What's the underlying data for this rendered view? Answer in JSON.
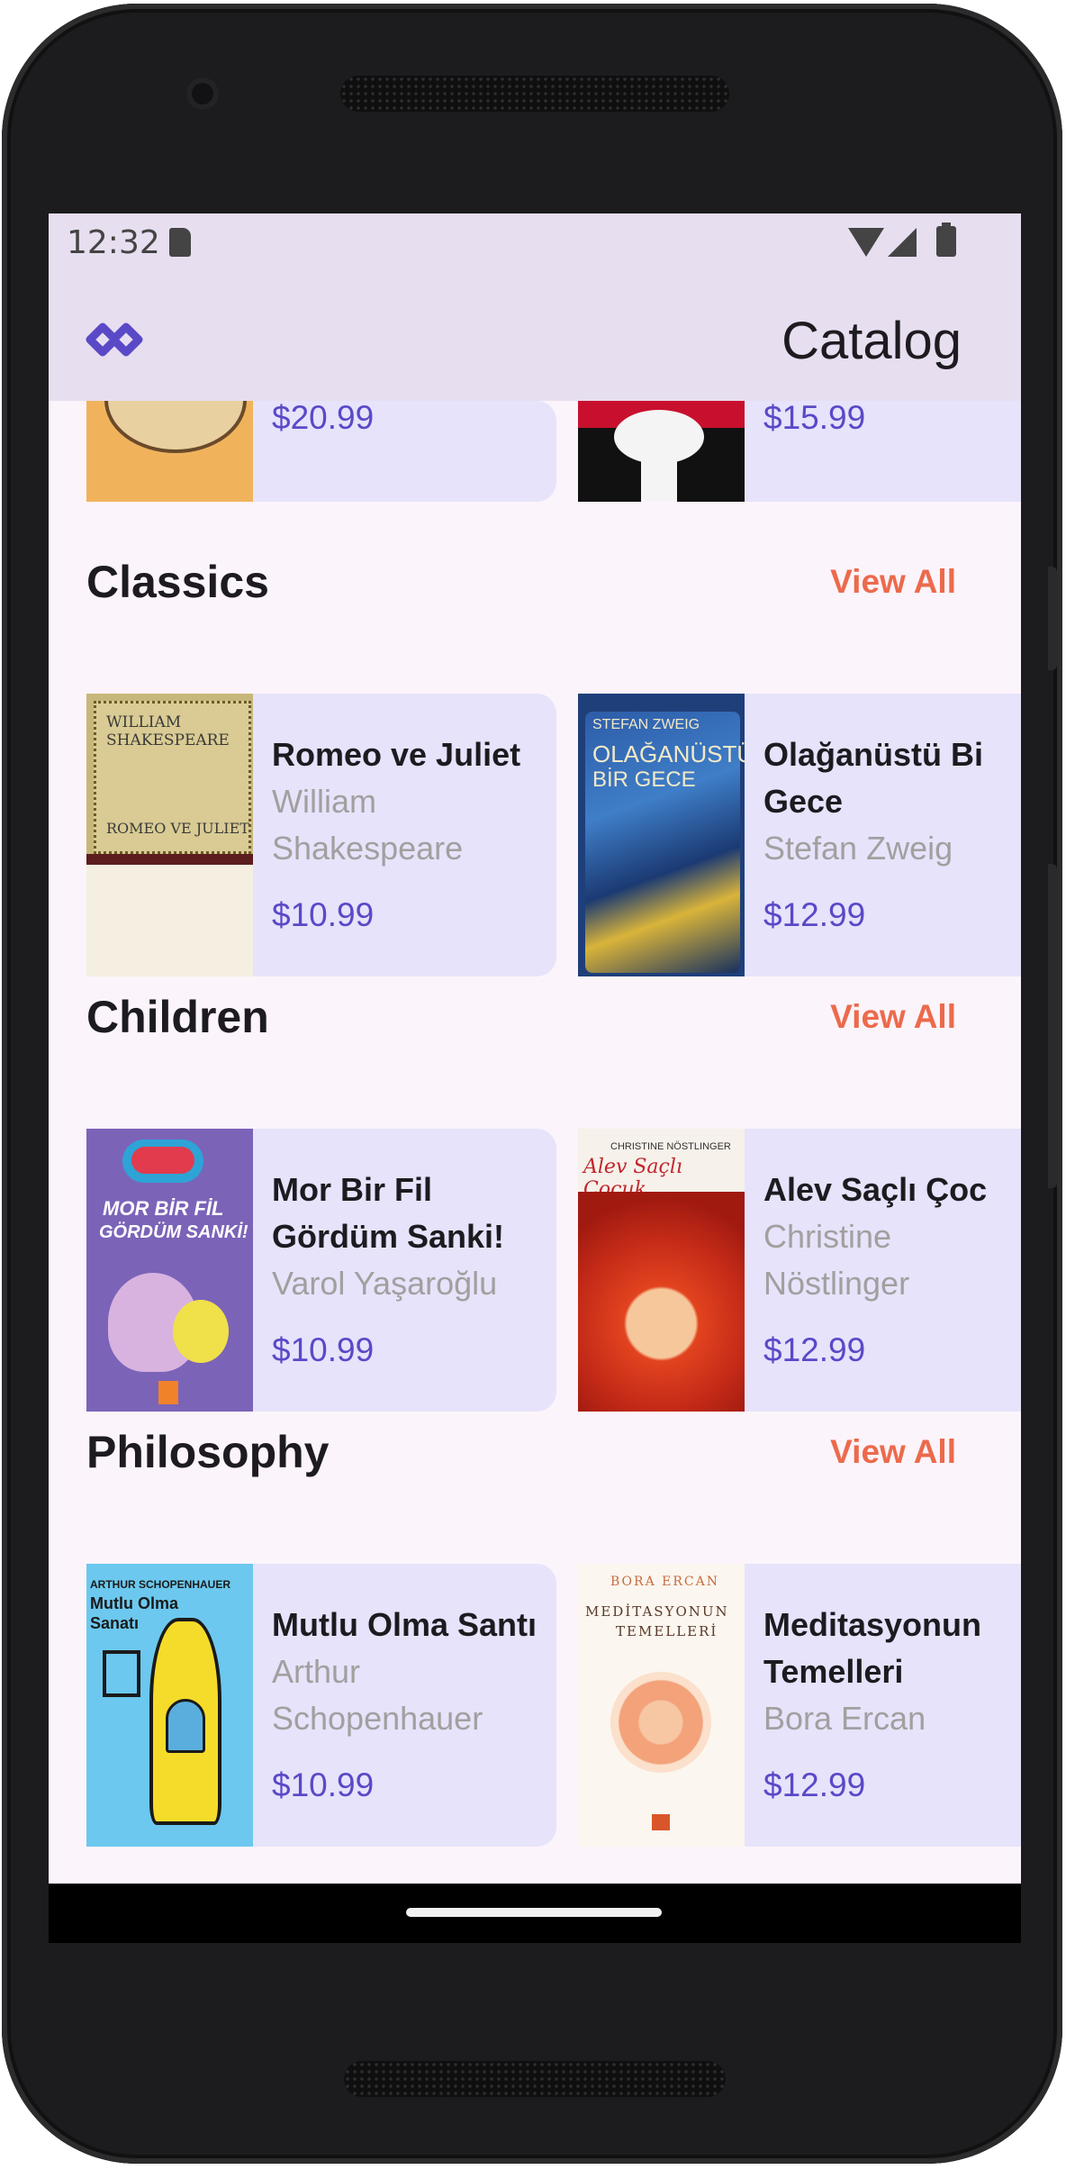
{
  "status": {
    "time": "12:32"
  },
  "appbar": {
    "title": "Catalog",
    "logo": "logo-icon"
  },
  "colors": {
    "accent": "#5a49c7",
    "view_all": "#ec6a4c",
    "card_bg": "#e6e3fb",
    "appbar_bg": "#e7def0"
  },
  "top_row": {
    "left_price": "$20.99",
    "right_price": "$15.99"
  },
  "sections": [
    {
      "title": "Classics",
      "view_all": "View All",
      "books": [
        {
          "title": "Romeo ve Juliet",
          "author": "William\nShakespeare",
          "price": "$10.99",
          "cover": {
            "line1": "WILLIAM",
            "line2": "SHAKESPEARE",
            "line3": "ROMEO VE JULIET"
          }
        },
        {
          "title": "Olağanüstü Bi\nGece",
          "author": "Stefan Zweig",
          "price": "$12.99",
          "cover": {
            "line1": "STEFAN ZWEIG",
            "line2": "OLAĞANÜSTÜ",
            "line3": "BİR GECE"
          }
        }
      ]
    },
    {
      "title": "Children",
      "view_all": "View All",
      "books": [
        {
          "title": "Mor Bir Fil\nGördüm Sanki!",
          "author": "Varol Yaşaroğlu",
          "price": "$10.99",
          "cover": {
            "line1": "MOR BİR FİL",
            "line2": "GÖRDÜM SANKİ!"
          }
        },
        {
          "title": "Alev Saçlı Çoc",
          "author": "Christine\nNöstlinger",
          "price": "$12.99",
          "cover": {
            "line1": "CHRISTINE NÖSTLINGER",
            "line2": "Alev Saçlı Çocuk"
          }
        }
      ]
    },
    {
      "title": "Philosophy",
      "view_all": "View All",
      "books": [
        {
          "title": "Mutlu Olma Santı",
          "author": "Arthur\nSchopenhauer",
          "price": "$10.99",
          "cover": {
            "line1": "ARTHUR SCHOPENHAUER",
            "line2": "Mutlu Olma",
            "line3": "Sanatı"
          }
        },
        {
          "title": "Meditasyonun\nTemelleri",
          "author": "Bora Ercan",
          "price": "$12.99",
          "cover": {
            "line1": "BORA ERCAN",
            "line2": "MEDİTASYONUN",
            "line3": "TEMELLERİ"
          }
        }
      ]
    }
  ]
}
